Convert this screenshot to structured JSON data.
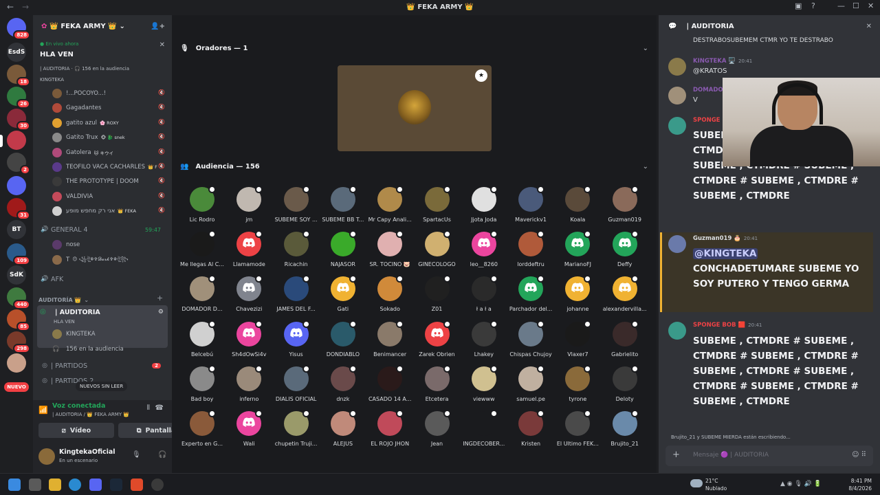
{
  "window": {
    "title": "👑 FEKA ARMY 👑",
    "back": "←",
    "forward": "→"
  },
  "servers": [
    {
      "label": "",
      "badge": "828",
      "color": "#5865f2"
    },
    {
      "label": "EsdS",
      "badge": "",
      "color": "#313338"
    },
    {
      "label": "",
      "badge": "18",
      "color": "#7a5a3a"
    },
    {
      "label": "",
      "badge": "26",
      "color": "#2f7a3f"
    },
    {
      "label": "",
      "badge": "30",
      "color": "#8a2a3a"
    },
    {
      "label": "",
      "badge": "",
      "color": "#c23a4a"
    },
    {
      "label": "",
      "badge": "2",
      "color": "#444"
    },
    {
      "label": "",
      "badge": "",
      "color": "#5865f2"
    },
    {
      "label": "",
      "badge": "31",
      "color": "#a01a1a"
    },
    {
      "label": "BT",
      "badge": "",
      "color": "#313338"
    },
    {
      "label": "",
      "badge": "109",
      "color": "#2a5a8a"
    },
    {
      "label": "SdK",
      "badge": "",
      "color": "#313338"
    },
    {
      "label": "",
      "badge": "440",
      "color": "#3f7a3f"
    },
    {
      "label": "",
      "badge": "85",
      "color": "#b8502a"
    },
    {
      "label": "",
      "badge": "298",
      "color": "#7a3a2a"
    },
    {
      "label": "",
      "badge": "",
      "color": "#c9a08a"
    }
  ],
  "rail_new": "NUEVO",
  "guild": {
    "name": "👑 FEKA ARMY 👑",
    "live_tag": "● En vivo ahora",
    "live_title": "HLA VEN",
    "live_meta": "| AUDITORIA · 🎧 156 en la audiencia",
    "live_host": "KINGTEKA"
  },
  "voice_users_top": [
    {
      "name": "!...POCOYO...!",
      "color": "#7a5a3a",
      "tag": ""
    },
    {
      "name": "Gagadantes",
      "color": "#b04a3a",
      "tag": ""
    },
    {
      "name": "gatito azul",
      "color": "#e0a030",
      "tag": "🌸 ROXY"
    },
    {
      "name": "Gatito Trux",
      "color": "#8a8a8a",
      "tag": "🐵 🐉 snek"
    },
    {
      "name": "Gatolera",
      "color": "#b04a7a",
      "tag": "🐱 キウイ"
    },
    {
      "name": "TEOFILO VACA CACHARLES",
      "color": "#5a3a8a",
      "tag": "👑 F"
    },
    {
      "name": "THE PROTOTYPE | DOOM",
      "color": "#3a3a3a",
      "tag": ""
    },
    {
      "name": "VALDIVIA",
      "color": "#c44a5a",
      "tag": ""
    },
    {
      "name": "אני רק מחפש מופע",
      "color": "#d0d0d0",
      "tag": "👑 FEKA"
    }
  ],
  "general_channel": {
    "name": "GENERAL 4",
    "time": "59:47"
  },
  "general_users": [
    {
      "name": "nose",
      "color": "#5a3a6a"
    },
    {
      "name": "T",
      "color": "#8a6a4a",
      "tag": "😊 ꧁ঔৣ☬✞𝓓𝓪𝓻𝓴✞☬ঔৣ꧂"
    }
  ],
  "afk_channel": "AFK",
  "category_auditoria": "AUDITORÍA 👑",
  "stage_channel": {
    "name": "| AUDITORIA",
    "sub": "HLA VEN",
    "host": "KINGTEKA",
    "audience": "156 en la audiencia"
  },
  "partidos": {
    "name": "| PARTIDOS",
    "badge": "2"
  },
  "partidos2": "| PARTIDOS 2",
  "new_unread": "NUEVOS SIN LEER",
  "voice_status": {
    "label": "Voz conectada",
    "sub": "| AUDITORIA / 👑 FEKA ARMY 👑",
    "video": "Vídeo",
    "screen": "Pantalla"
  },
  "current_user": {
    "name": "KingtekaOficial",
    "status": "En un escenario"
  },
  "stage": {
    "speakers_header": "Oradores — 1",
    "audience_header": "Audiencia — 156",
    "audience": [
      {
        "name": "Lic Rodro",
        "color": "#4a8a3a",
        "discord": false
      },
      {
        "name": "jm",
        "color": "#c0b8b0",
        "discord": false
      },
      {
        "name": "SUBEME SOY ...",
        "color": "#6a5a4a",
        "discord": false
      },
      {
        "name": "SUBEME BB T...",
        "color": "#5a6a7a",
        "discord": false
      },
      {
        "name": "Mr Capy Anali...",
        "color": "#b08a4a",
        "discord": false
      },
      {
        "name": "SpartacUs",
        "color": "#7a6a3a",
        "discord": false
      },
      {
        "name": "Jjota Joda",
        "color": "#e0e0e0",
        "discord": false
      },
      {
        "name": "Maverickv1",
        "color": "#4a5a7a",
        "discord": false
      },
      {
        "name": "Koala",
        "color": "#5a4a3a",
        "discord": false
      },
      {
        "name": "Guzman019",
        "color": "#8a6a5a",
        "discord": false
      },
      {
        "name": "Me llegas Al C...",
        "color": "#1a1a1a",
        "discord": false
      },
      {
        "name": "Llamamode",
        "color": "#ed4245",
        "discord": true
      },
      {
        "name": "Ricachin",
        "color": "#5a5a3a",
        "discord": false
      },
      {
        "name": "NAJASOR",
        "color": "#3aaa2a",
        "discord": false
      },
      {
        "name": "SR. TOCINO 🐷",
        "color": "#e0b0b0",
        "discord": false
      },
      {
        "name": "GINECOLOGO",
        "color": "#d0b070",
        "discord": false
      },
      {
        "name": "leo__8260",
        "color": "#eb459e",
        "discord": true
      },
      {
        "name": "lorddeftru",
        "color": "#b05a3a",
        "discord": false
      },
      {
        "name": "MarianoFJ",
        "color": "#23a55a",
        "discord": true
      },
      {
        "name": "Deffy",
        "color": "#23a55a",
        "discord": true
      },
      {
        "name": "DOMADOR D...",
        "color": "#a0907a",
        "discord": false
      },
      {
        "name": "Chavezizi",
        "color": "#80848e",
        "discord": true
      },
      {
        "name": "JAMES DEL F...",
        "color": "#2a4a7a",
        "discord": false
      },
      {
        "name": "Gati",
        "color": "#f0b232",
        "discord": true
      },
      {
        "name": "Sokado",
        "color": "#d08a3a",
        "discord": false
      },
      {
        "name": "Z01",
        "color": "#202020",
        "discord": false
      },
      {
        "name": "ł a ł a",
        "color": "#2a2a2a",
        "discord": false
      },
      {
        "name": "Parchador del...",
        "color": "#23a55a",
        "discord": true
      },
      {
        "name": "johanne",
        "color": "#f0b232",
        "discord": true
      },
      {
        "name": "alexandervilla...",
        "color": "#f0b232",
        "discord": true
      },
      {
        "name": "Belcebú",
        "color": "#d0d0d0",
        "discord": false
      },
      {
        "name": "Sh4dOwSi4v",
        "color": "#eb459e",
        "discord": true
      },
      {
        "name": "Yisus",
        "color": "#5865f2",
        "discord": true
      },
      {
        "name": "DONDIABLO",
        "color": "#2a5a6a",
        "discord": false
      },
      {
        "name": "Benimancer",
        "color": "#8a7a6a",
        "discord": false
      },
      {
        "name": "Zarek Obrien",
        "color": "#ed4245",
        "discord": true
      },
      {
        "name": "Lhakey",
        "color": "#3a3a3a",
        "discord": false
      },
      {
        "name": "Chispas Chujoy",
        "color": "#6a7a8a",
        "discord": false
      },
      {
        "name": "Vlaxer7",
        "color": "#1a1a1a",
        "discord": false
      },
      {
        "name": "Gabrielito",
        "color": "#3a2a2a",
        "discord": false
      },
      {
        "name": "Bad boy",
        "color": "#8a8a8a",
        "discord": false
      },
      {
        "name": "inferno",
        "color": "#9a8a7a",
        "discord": false
      },
      {
        "name": "DIALIS OFICIAL",
        "color": "#5a6a7a",
        "discord": false
      },
      {
        "name": "dnzk",
        "color": "#6a4a4a",
        "discord": false
      },
      {
        "name": "CASADO 14 A...",
        "color": "#2a1a1a",
        "discord": false
      },
      {
        "name": "Etcetera",
        "color": "#7a6a6a",
        "discord": false
      },
      {
        "name": "viewww",
        "color": "#d0c090",
        "discord": false
      },
      {
        "name": "samuel.pe",
        "color": "#c0b0a0",
        "discord": false
      },
      {
        "name": "tyrone",
        "color": "#8a6a3a",
        "discord": false
      },
      {
        "name": "Deloty",
        "color": "#3a3a3a",
        "discord": false
      },
      {
        "name": "Experto en G...",
        "color": "#8a5a3a",
        "discord": false
      },
      {
        "name": "Wali",
        "color": "#eb459e",
        "discord": true
      },
      {
        "name": "chupetin Truji...",
        "color": "#9a9a6a",
        "discord": false
      },
      {
        "name": "ALEJUS",
        "color": "#c08a7a",
        "discord": false
      },
      {
        "name": "EL ROJO JHON",
        "color": "#c04a5a",
        "discord": false
      },
      {
        "name": "Jean",
        "color": "#5a5a5a",
        "discord": false
      },
      {
        "name": "INGDECOBER...",
        "color": "#1a1b1e",
        "discord": false
      },
      {
        "name": "Kristen",
        "color": "#7a3a3a",
        "discord": false
      },
      {
        "name": "El Ultimo FEK...",
        "color": "#4a4a4a",
        "discord": false
      },
      {
        "name": "Brujito_21",
        "color": "#6a8aaa",
        "discord": false
      }
    ]
  },
  "chat": {
    "header": "| AUDITORIA",
    "top_line": "DESTRABOSUBEMEM CTMR YO TE DESTRABO",
    "messages": [
      {
        "name": "KINGTEKA 🖥️",
        "time": "20:41",
        "name_color": "#8a5ab0",
        "text": "@KRATOS",
        "avatar": "#8a7a4a"
      },
      {
        "name": "DOMADOR",
        "time": "",
        "name_color": "#8a5ab0",
        "text": "V",
        "avatar": "#a0907a"
      },
      {
        "name": "SPONGE",
        "time": "",
        "name_color": "#ed4245",
        "text": "",
        "avatar": "#3a9a8a"
      }
    ],
    "spam1": "SUBEME , CTMDRE # SUBEME , CTMDRE # SUBEME , CTMDRE # SUBEME , CTMDRE # SUBEME , CTMDRE # SUBEME , CTMDRE # SUBEME , CTMDRE",
    "guzman": {
      "name": "Guzman019 🎂",
      "time": "20:41",
      "mention": "@KINGTEKA",
      "text": "CONCHADETUMARE SUBEME YO SOY PUTERO Y TENGO GERMA"
    },
    "sponge2": {
      "name": "SPONGE BOB 🟥",
      "time": "20:41",
      "text": "SUBEME , CTMDRE # SUBEME , CTMDRE # SUBEME , CTMDRE # SUBEME , CTMDRE # SUBEME , CTMDRE # SUBEME , CTMDRE # SUBEME , CTMDRE"
    },
    "typing": "Brujito_21 y SUBEME MIERDA están escribiendo...",
    "composer_placeholder": "Mensaje 🟣 | AUDITORIA"
  },
  "taskbar": {
    "weather_temp": "21°C",
    "weather_desc": "Nublado",
    "time": "8:41 PM",
    "date": "8/4/2026"
  }
}
